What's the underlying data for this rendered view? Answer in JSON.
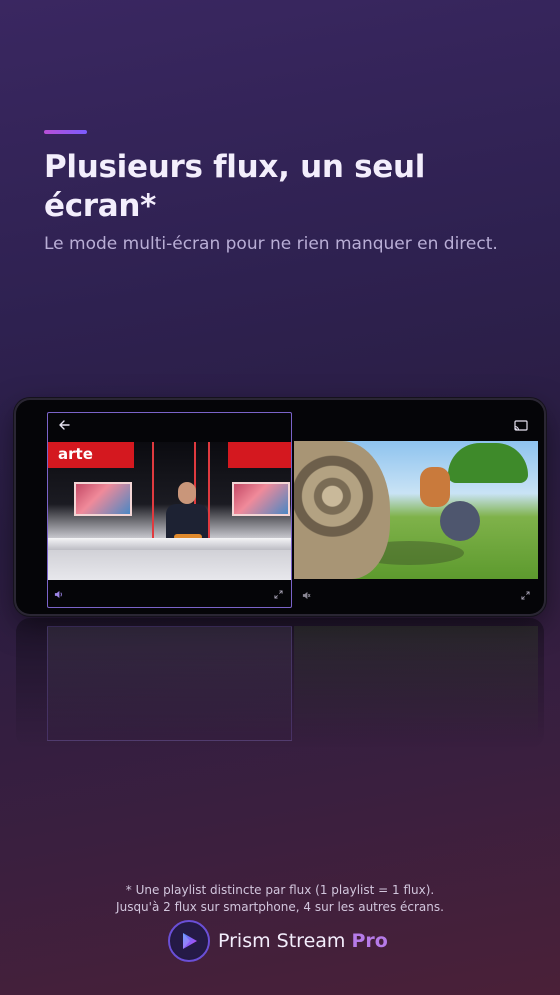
{
  "headline": "Plusieurs flux, un seul écran*",
  "subline": "Le mode multi-écran pour ne rien manquer en direct.",
  "player": {
    "left_pane": {
      "channel_logo": "arte",
      "back_icon": "arrow-back-icon",
      "volume_icon": "volume-icon",
      "expand_icon": "expand-icon"
    },
    "right_pane": {
      "cast_icon": "cast-icon",
      "mute_icon": "mute-icon",
      "expand_icon": "expand-icon"
    }
  },
  "footnote": {
    "line1": "* Une playlist distincte par flux (1 playlist = 1 flux).",
    "line2": "Jusqu'à 2 flux sur smartphone, 4 sur les autres écrans."
  },
  "brand": {
    "name": "Prism Stream",
    "suffix": "Pro",
    "logo_icon": "prism-play-logo-icon"
  },
  "colors": {
    "accent": "#7b5cff",
    "accent_pink": "#b84fd6",
    "pro": "#b67be8",
    "focus_border": "#7a63c9"
  }
}
